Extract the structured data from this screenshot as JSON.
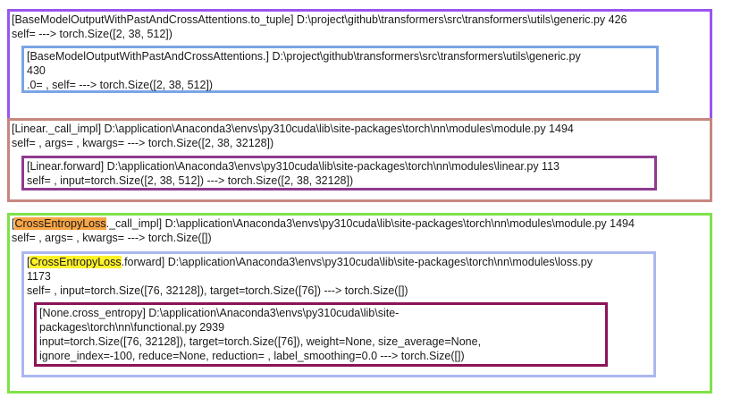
{
  "frames": {
    "to_tuple": {
      "header": "[BaseModelOutputWithPastAndCrossAttentions.to_tuple] D:\\project\\github\\transformers\\src\\transformers\\utils\\generic.py 426",
      "args": "self= ---> torch.Size([2, 38, 512])",
      "child": {
        "header_line1": "[BaseModelOutputWithPastAndCrossAttentions.] D:\\project\\github\\transformers\\src\\transformers\\utils\\generic.py",
        "header_line2": "430",
        "args": ".0= , self= ---> torch.Size([2, 38, 512])"
      }
    },
    "linear_call_impl": {
      "header": "[Linear._call_impl] D:\\application\\Anaconda3\\envs\\py310cuda\\lib\\site-packages\\torch\\nn\\modules\\module.py 1494",
      "args": "self= , args= , kwargs= ---> torch.Size([2, 38, 32128])",
      "child": {
        "header": "[Linear.forward] D:\\application\\Anaconda3\\envs\\py310cuda\\lib\\site-packages\\torch\\nn\\modules\\linear.py 113",
        "args": "self= , input=torch.Size([2, 38, 512]) ---> torch.Size([2, 38, 32128])"
      }
    },
    "cel_call_impl": {
      "bracket_open": "[",
      "highlight": "CrossEntropyLoss",
      "header_rest": "._call_impl] D:\\application\\Anaconda3\\envs\\py310cuda\\lib\\site-packages\\torch\\nn\\modules\\module.py 1494",
      "args": "self= , args= , kwargs= ---> torch.Size([])",
      "child": {
        "bracket_open": "[",
        "highlight": "CrossEntropyLoss",
        "header_rest": ".forward] D:\\application\\Anaconda3\\envs\\py310cuda\\lib\\site-packages\\torch\\nn\\modules\\loss.py",
        "header_line2": "1173",
        "args": "self= , input=torch.Size([76, 32128]), target=torch.Size([76]) ---> torch.Size([])",
        "child": {
          "header_line1": "[None.cross_entropy] D:\\application\\Anaconda3\\envs\\py310cuda\\lib\\site-",
          "header_line2": "packages\\torch\\nn\\functional.py 2939",
          "args_line1": "input=torch.Size([76, 32128]), target=torch.Size([76]), weight=None, size_average=None,",
          "args_line2": "ignore_index=-100, reduce=None, reduction= , label_smoothing=0.0 ---> torch.Size([])"
        }
      }
    }
  },
  "colors": {
    "to_tuple_border": "#9a55f0",
    "to_tuple_child_border": "#7aa5e6",
    "linear_border": "#c78780",
    "linear_child_border": "#8e3b8e",
    "cel_border": "#80e24a",
    "cel_child_border": "#aab7ef",
    "cross_entropy_border": "#8c1458",
    "highlight_orange": "#f7a545",
    "highlight_yellow": "#fff22a"
  }
}
